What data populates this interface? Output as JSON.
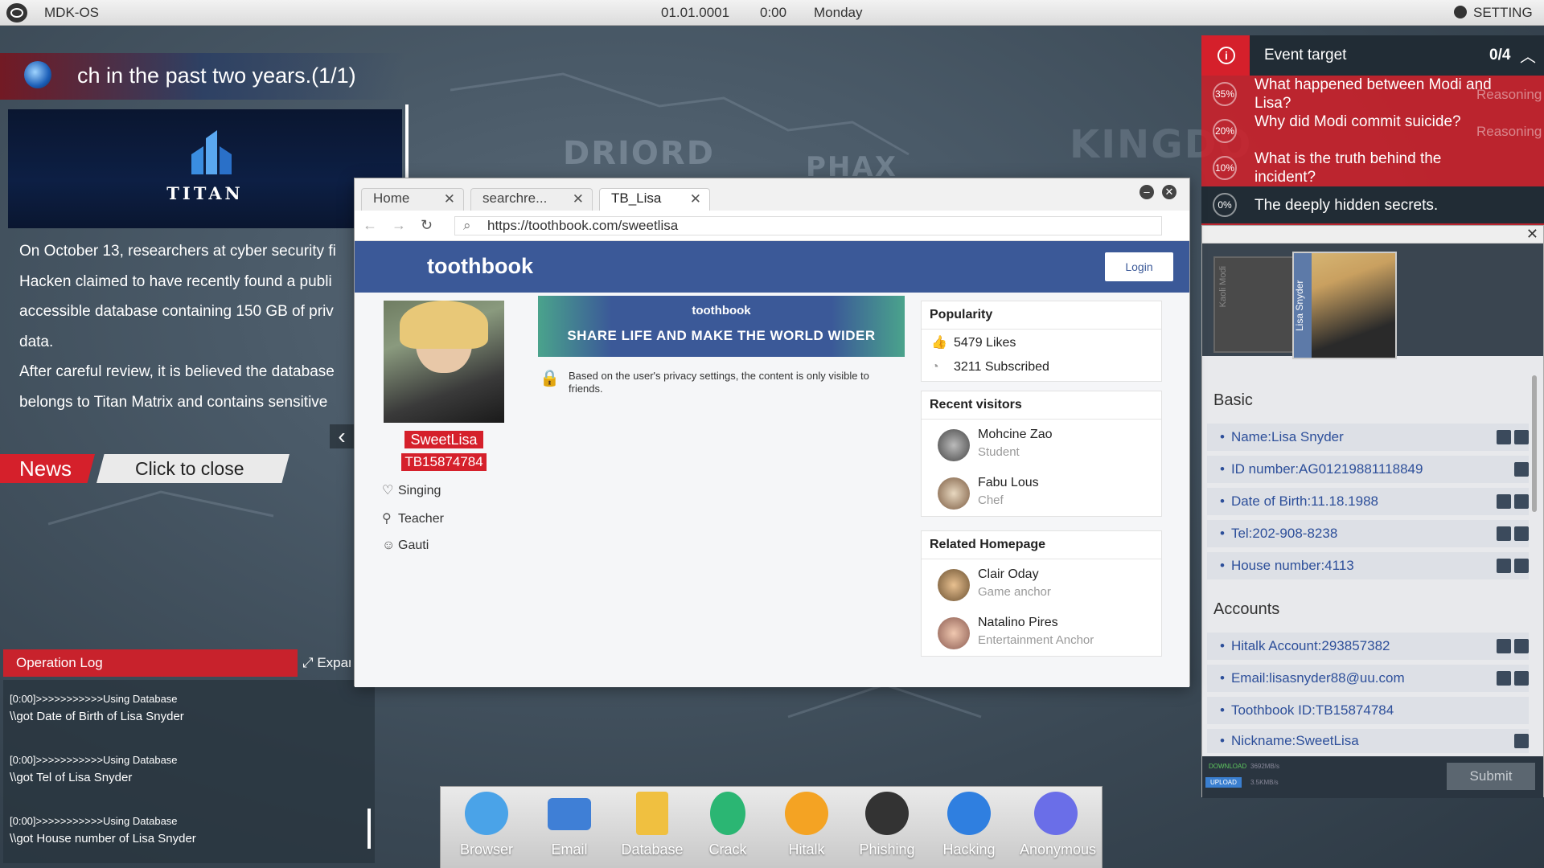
{
  "topbar": {
    "app_name": "MDK-OS",
    "date": "01.01.0001",
    "time": "0:00",
    "day": "Monday",
    "setting_label": "SETTING"
  },
  "map": {
    "labels": [
      "DRIORD",
      "PHAX",
      "KINGDO"
    ]
  },
  "news": {
    "headline": "ch in the past two years.(1/1)",
    "logo_text": "TITAN",
    "paragraphs": [
      "On October 13, researchers at cyber security fi",
      "Hacken claimed to have recently found a publi",
      "accessible database containing 150 GB of priv",
      "data.",
      "After careful review, it is believed the database",
      "belongs to Titan Matrix and contains sensitive"
    ],
    "tab_label": "News",
    "close_label": "Click to close"
  },
  "oplog": {
    "title": "Operation Log",
    "expand_label": "Expan",
    "entries": [
      {
        "ts": "[0:00]>>>>>>>>>>>Using Database",
        "msg": "\\\\got Date of Birth of Lisa Snyder"
      },
      {
        "ts": "[0:00]>>>>>>>>>>>Using Database",
        "msg": "\\\\got Tel of Lisa Snyder"
      },
      {
        "ts": "[0:00]>>>>>>>>>>>Using Database",
        "msg": "\\\\got House number of Lisa Snyder"
      }
    ]
  },
  "browser": {
    "tabs": [
      {
        "label": "Home"
      },
      {
        "label": "searchre..."
      },
      {
        "label": "TB_Lisa"
      }
    ],
    "url": "https://toothbook.com/sweetlisa",
    "site_logo": "toothbook",
    "login_label": "Login",
    "profile": {
      "nickname": "SweetLisa",
      "id": "TB15874784",
      "items": [
        {
          "icon": "heart-icon",
          "label": "Singing"
        },
        {
          "icon": "tie-icon",
          "label": "Teacher"
        },
        {
          "icon": "person-icon",
          "label": "Gauti"
        }
      ]
    },
    "banner": {
      "brand": "toothbook",
      "slogan": "SHARE LIFE AND MAKE THE WORLD WIDER"
    },
    "privacy_text": "Based on the user's privacy settings, the content is only visible to friends.",
    "popularity": {
      "title": "Popularity",
      "likes": "5479 Likes",
      "subscribed": "3211 Subscribed"
    },
    "recent_visitors": {
      "title": "Recent visitors",
      "people": [
        {
          "name": "Mohcine Zao",
          "role": "Student"
        },
        {
          "name": "Fabu Lous",
          "role": "Chef"
        }
      ]
    },
    "related": {
      "title": "Related Homepage",
      "people": [
        {
          "name": "Clair Oday",
          "role": "Game anchor"
        },
        {
          "name": "Natalino Pires",
          "role": "Entertainment Anchor"
        }
      ]
    }
  },
  "event": {
    "title": "Event target",
    "progress": "0/4",
    "items": [
      {
        "pct": "35%",
        "text": "What happened between Modi and Lisa?",
        "status": "Reasoning"
      },
      {
        "pct": "20%",
        "text": "Why did Modi commit suicide?",
        "status": "Reasoning"
      },
      {
        "pct": "10%",
        "text": "What is the truth behind the incident?",
        "status": ""
      },
      {
        "pct": "0%",
        "text": "The deeply hidden secrets.",
        "status": ""
      }
    ]
  },
  "dossier": {
    "card_back": "Kaoli Modi",
    "card_front": "Lisa Snyder",
    "basic_title": "Basic",
    "basic": [
      "Name:Lisa Snyder",
      "ID number:AG01219881118849",
      "Date of Birth:11.18.1988",
      "Tel:202-908-8238",
      "House number:4113"
    ],
    "accounts_title": "Accounts",
    "accounts": [
      "Hitalk Account:293857382",
      "Email:lisasnyder88@uu.com",
      "Toothbook ID:TB15874784",
      "Nickname:SweetLisa"
    ],
    "download_label": "DOWNLOAD",
    "download_speed": "3692MB/s",
    "upload_label": "UPLOAD",
    "upload_speed": "3.5KMB/s",
    "submit_label": "Submit"
  },
  "dock": [
    {
      "label": "Browser",
      "color": "#4aa3e8"
    },
    {
      "label": "Email",
      "color": "#3f7fd6"
    },
    {
      "label": "Database",
      "color": "#f0c040"
    },
    {
      "label": "Crack",
      "color": "#2bb673"
    },
    {
      "label": "Hitalk",
      "color": "#f4a323"
    },
    {
      "label": "Phishing",
      "color": "#333333"
    },
    {
      "label": "Hacking",
      "color": "#2f7fe0"
    },
    {
      "label": "Anonymous",
      "color": "#6a6ee8"
    }
  ]
}
